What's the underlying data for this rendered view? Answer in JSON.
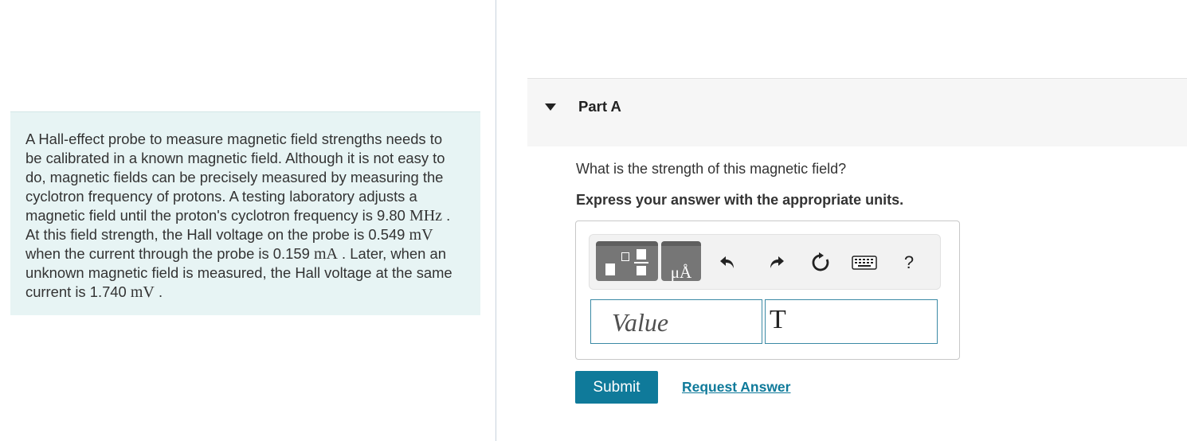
{
  "problem": {
    "text_1": "A Hall-effect probe to measure magnetic field strengths needs to be calibrated in a known magnetic field. Although it is not easy to do, magnetic fields can be precisely measured by measuring the cyclotron frequency of protons. A testing laboratory adjusts a magnetic field until the proton's cyclotron frequency is 9.80 ",
    "unit_freq": "MHz",
    "text_2": " . At this field strength, the Hall voltage on the probe is 0.549 ",
    "unit_v1": "mV",
    "text_3": " when the current through the probe is 0.159 ",
    "unit_current": "mA",
    "text_4": " . Later, when an unknown magnetic field is measured, the Hall voltage at the same current is 1.740 ",
    "unit_v2": "mV",
    "text_5": " ."
  },
  "part": {
    "title": "Part A",
    "question": "What is the strength of this magnetic field?",
    "instruction": "Express your answer with the appropriate units."
  },
  "toolbar": {
    "units_glyph": "μÅ",
    "help_label": "?",
    "icons": [
      "templates-icon",
      "units-icon",
      "undo-icon",
      "redo-icon",
      "reset-icon",
      "keyboard-icon",
      "help-icon"
    ]
  },
  "answer": {
    "value_placeholder": "Value",
    "unit_value": "T"
  },
  "actions": {
    "submit_label": "Submit",
    "request_label": "Request Answer"
  },
  "colors": {
    "accent": "#0f7a9a",
    "problem_bg": "#e7f4f4",
    "header_bg": "#f6f6f6"
  }
}
